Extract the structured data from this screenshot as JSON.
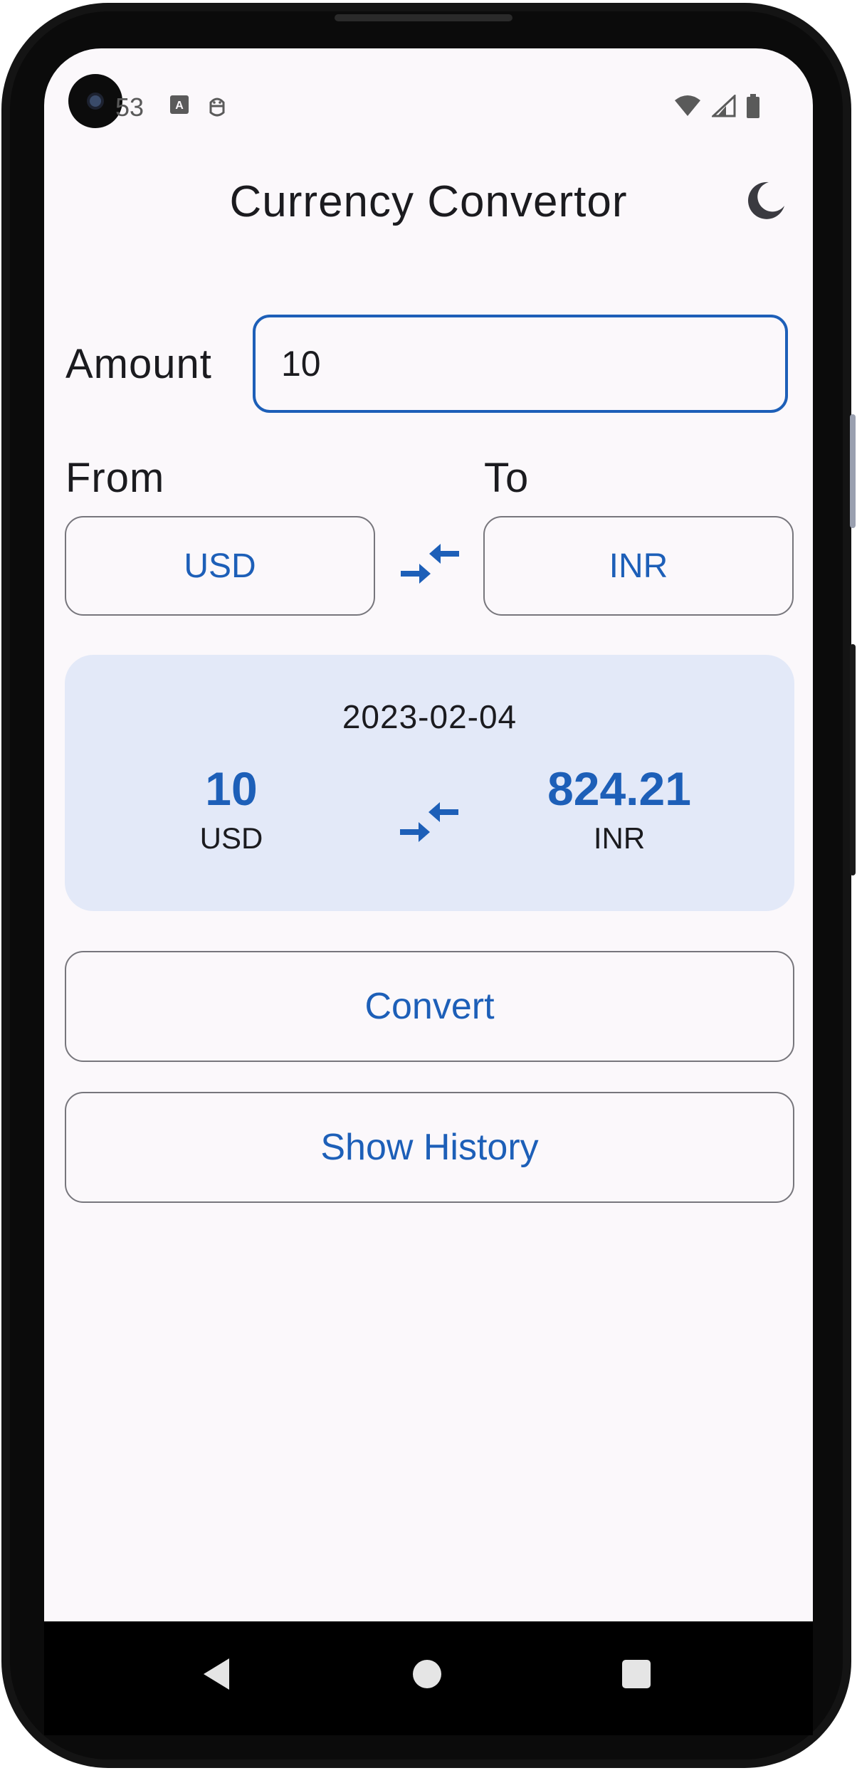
{
  "status_bar": {
    "time": "53"
  },
  "header": {
    "title": "Currency Convertor",
    "theme_icon": "moon-icon"
  },
  "amount": {
    "label": "Amount",
    "value": "10"
  },
  "currency_select": {
    "from_label": "From",
    "to_label": "To",
    "from_value": "USD",
    "to_value": "INR",
    "swap_icon": "swap-arrows-icon"
  },
  "result": {
    "date": "2023-02-04",
    "from_amount": "10",
    "from_code": "USD",
    "to_amount": "824.21",
    "to_code": "INR"
  },
  "actions": {
    "convert_label": "Convert",
    "history_label": "Show History"
  },
  "colors": {
    "accent": "#1d5fb8",
    "background": "#fbf8fb",
    "card": "#e3e9f8",
    "outline": "#77767c"
  }
}
